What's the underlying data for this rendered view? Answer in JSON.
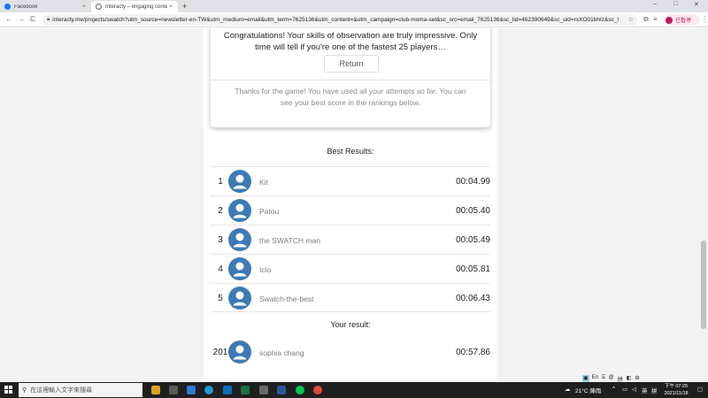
{
  "browser": {
    "tabs": [
      {
        "label": "Facebook",
        "close": "×"
      },
      {
        "label": "Interacty – engaging content",
        "close": "×"
      }
    ],
    "new_tab": "+",
    "window_controls": [
      "–",
      "□",
      "✕"
    ],
    "nav": {
      "back": "←",
      "forward": "→",
      "reload": "C"
    },
    "url": "interacty.me/projects/swatch?utm_source=newsletter-en-TW&utm_medium=email&utm_term=7625136&utm_content=&utm_campaign=club-moma-set&sc_src=email_7625136&sc_lid=462390649&sc_uid=rxXO01bhIz&sc_llid=192&sc_...",
    "profile_label": "已暫停"
  },
  "game": {
    "congrats_text": "Congratulations! Your skills of observation are truly impressive. Only time will tell if you're one of the fastest 25 players…",
    "return_label": "Return",
    "thanks_text": "Thanks for the game! You have used all your attempts so far. You can see your best score in the rankings below.",
    "best_results_title": "Best Results:",
    "best_results": [
      {
        "rank": "1",
        "name": "Kit",
        "time": "00:04.99"
      },
      {
        "rank": "2",
        "name": "Patou",
        "time": "00:05.40"
      },
      {
        "rank": "3",
        "name": "the SWATCH man",
        "time": "00:05.49"
      },
      {
        "rank": "4",
        "name": "Icio",
        "time": "00:05.81"
      },
      {
        "rank": "5",
        "name": "Swatch-the-best",
        "time": "00:06.43"
      }
    ],
    "your_result_title": "Your result:",
    "your_result": {
      "rank": "201",
      "name": "sophia chang",
      "time": "00:57.86"
    }
  },
  "taskbar": {
    "search_placeholder": "在這裡輸入文字來搜尋",
    "weather": "21°C 陣雨",
    "time": "下午 07:25",
    "date": "2021/11/18",
    "ime": [
      "En",
      "⌸",
      "@",
      "拼",
      "◧",
      "⚙"
    ]
  },
  "colors": {
    "accent": "#3d7ab5",
    "page_bg": "#f2f2f2"
  }
}
